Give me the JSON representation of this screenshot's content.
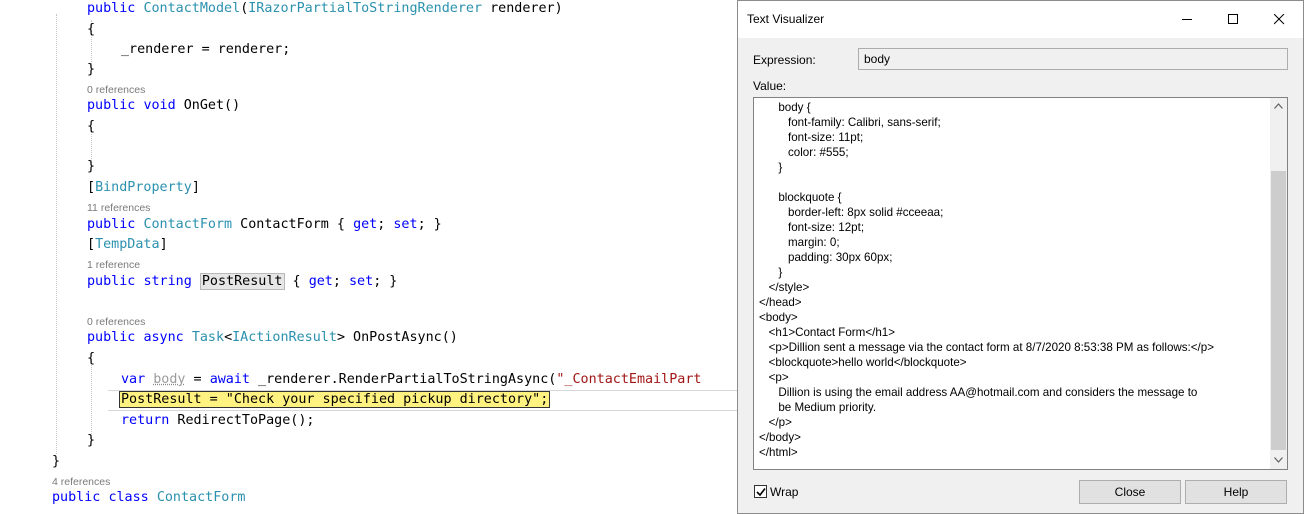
{
  "editor": {
    "lines": {
      "ctor": {
        "kw1": "public",
        "type1": "ContactModel",
        "open": "(",
        "type2": "IRazorPartialToStringRenderer",
        "rest": " renderer)"
      },
      "brace1": "{",
      "assign": "_renderer = renderer;",
      "brace2": "}",
      "ref_onget": "0 references",
      "onget": {
        "kw1": "public",
        "kw2": "void",
        "rest": " OnGet()"
      },
      "brace3": "{",
      "brace4": "}",
      "bindprop": {
        "open": "[",
        "type": "BindProperty",
        "close": "]"
      },
      "ref_contactform": "11 references",
      "prop_contactform": {
        "kw1": "public",
        "type": "ContactForm",
        "name": " ContactForm { ",
        "get": "get",
        "semi1": "; ",
        "set": "set",
        "end": "; }"
      },
      "tempdata": {
        "open": "[",
        "type": "TempData",
        "close": "]"
      },
      "ref_postresult": "1 reference",
      "prop_postresult": {
        "kw1": "public",
        "kw2": "string",
        "name": "PostResult",
        "mid": " { ",
        "get": "get",
        "semi1": "; ",
        "set": "set",
        "end": "; }"
      },
      "ref_onpost": "0 references",
      "onpost": {
        "kw1": "public",
        "kw2": "async",
        "type1": "Task",
        "lt": "<",
        "type2": "IActionResult",
        "rest": "> OnPostAsync()"
      },
      "brace5": "{",
      "var_line": {
        "kw1": "var",
        "varname": "body",
        "eq": " = ",
        "kw2": "await",
        "call": " _renderer.RenderPartialToStringAsync(",
        "str": "\"_ContactEmailPart"
      },
      "postresult_assign": "PostResult = \"Check your specified pickup directory\";",
      "return_line": {
        "kw": "return",
        "rest": " RedirectToPage();"
      },
      "brace6": "}",
      "brace7": "}",
      "ref_class": "4 references",
      "class_line": {
        "kw1": "public",
        "kw2": "class",
        "type": "ContactForm"
      }
    }
  },
  "dialog": {
    "title": "Text Visualizer",
    "expression_label": "Expression:",
    "expression_value": "body",
    "value_label": "Value:",
    "value_text": "      body {\n         font-family: Calibri, sans-serif;\n         font-size: 11pt;\n         color: #555;\n      }\n\n      blockquote {\n         border-left: 8px solid #cceeaa;\n         font-size: 12pt;\n         margin: 0;\n         padding: 30px 60px;\n      }\n   </style>\n</head>\n<body>\n   <h1>Contact Form</h1>\n   <p>Dillion sent a message via the contact form at 8/7/2020 8:53:38 PM as follows:</p>\n   <blockquote>hello world</blockquote>\n   <p>\n      Dillion is using the email address AA@hotmail.com and considers the message to\n      be Medium priority.\n   </p>\n</body>\n</html>",
    "wrap_label": "Wrap",
    "wrap_checked": true,
    "close_label": "Close",
    "help_label": "Help"
  }
}
